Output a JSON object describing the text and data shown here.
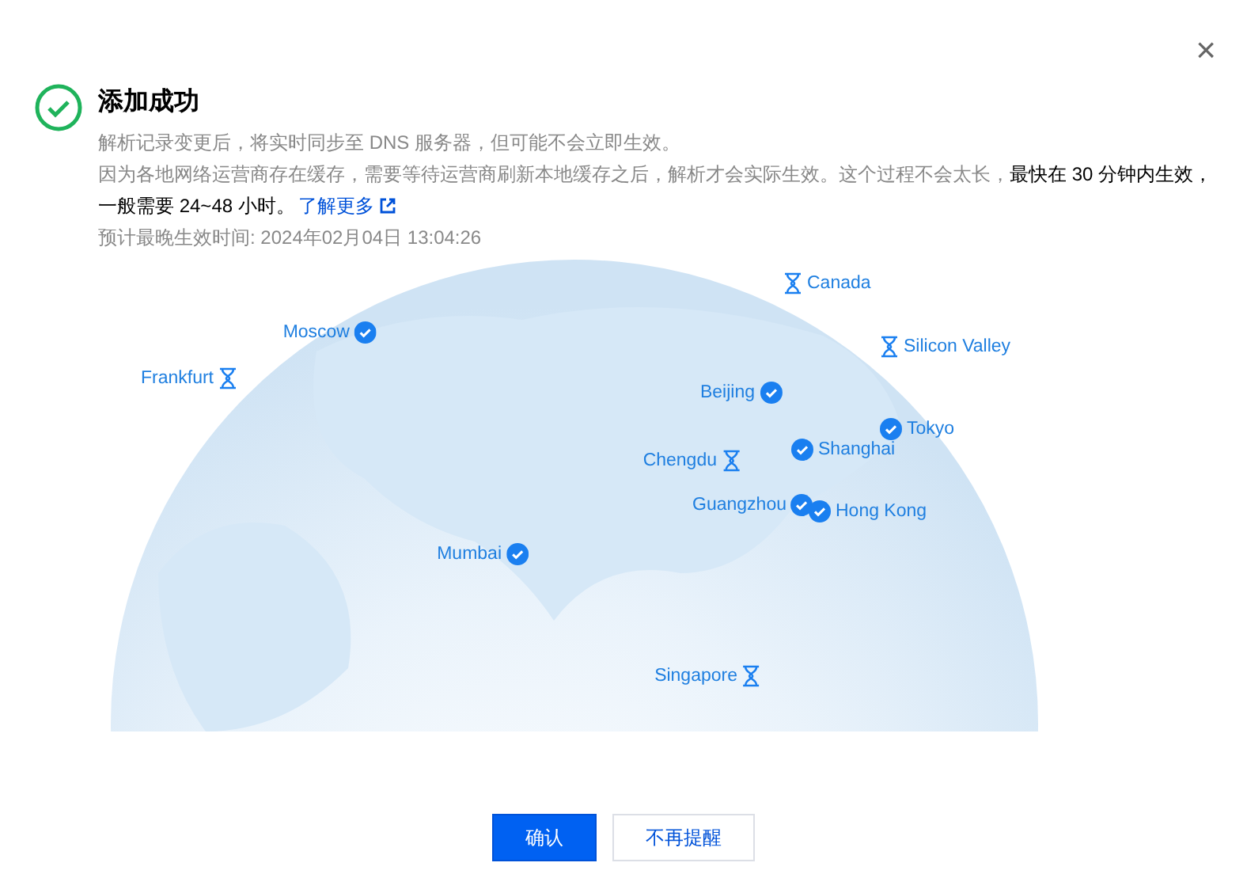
{
  "dialog": {
    "title": "添加成功",
    "close": "×",
    "lines": [
      "解析记录变更后，将实时同步至 DNS 服务器，但可能不会立即生效。"
    ],
    "notice": {
      "text": "因为各地网络运营商存在缓存，需要等待运营商刷新本地缓存之后，解析才会实际生效。这个过程不会太长，**最快在 30 分钟内生效，一般需要 24~48 小时。**",
      "link": "了解更多"
    },
    "eta": "预计最晚生效时间: 2024年02月04日 13:04:26"
  },
  "map": {
    "cities": [
      {
        "name": "Canada",
        "kind": "pending"
      },
      {
        "name": "Moscow",
        "kind": "done"
      },
      {
        "name": "Frankfurt",
        "kind": "pending"
      },
      {
        "name": "Silicon Valley",
        "kind": "pending"
      },
      {
        "name": "Beijing",
        "kind": "done"
      },
      {
        "name": "Tokyo",
        "kind": "done"
      },
      {
        "name": "Shanghai",
        "kind": "done"
      },
      {
        "name": "Chengdu",
        "kind": "pending"
      },
      {
        "name": "Guangzhou",
        "kind": "done"
      },
      {
        "name": "Hong Kong",
        "kind": "done"
      },
      {
        "name": "Mumbai",
        "kind": "done"
      },
      {
        "name": "Singapore",
        "kind": "pending"
      }
    ]
  },
  "buttons": [
    {
      "label": "确认",
      "kind": "primary"
    },
    {
      "label": "不再提醒",
      "kind": "secondary"
    }
  ]
}
